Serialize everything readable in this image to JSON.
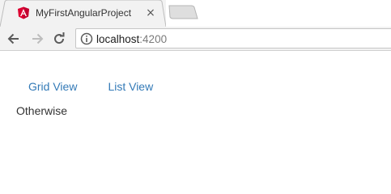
{
  "browser": {
    "tab_title": "MyFirstAngularProject",
    "close_glyph": "×",
    "url_host": "localhost",
    "url_port": ":4200",
    "icons": [
      "angular-favicon",
      "close-icon",
      "back-arrow-icon",
      "forward-arrow-icon",
      "reload-icon",
      "info-icon"
    ]
  },
  "page": {
    "nav_links": [
      "Grid View",
      "List View"
    ],
    "view_text": "Otherwise"
  },
  "colors": {
    "link": "#337ab7",
    "angular_red": "#dd0031",
    "tab_bg": "#f2f2f2"
  }
}
